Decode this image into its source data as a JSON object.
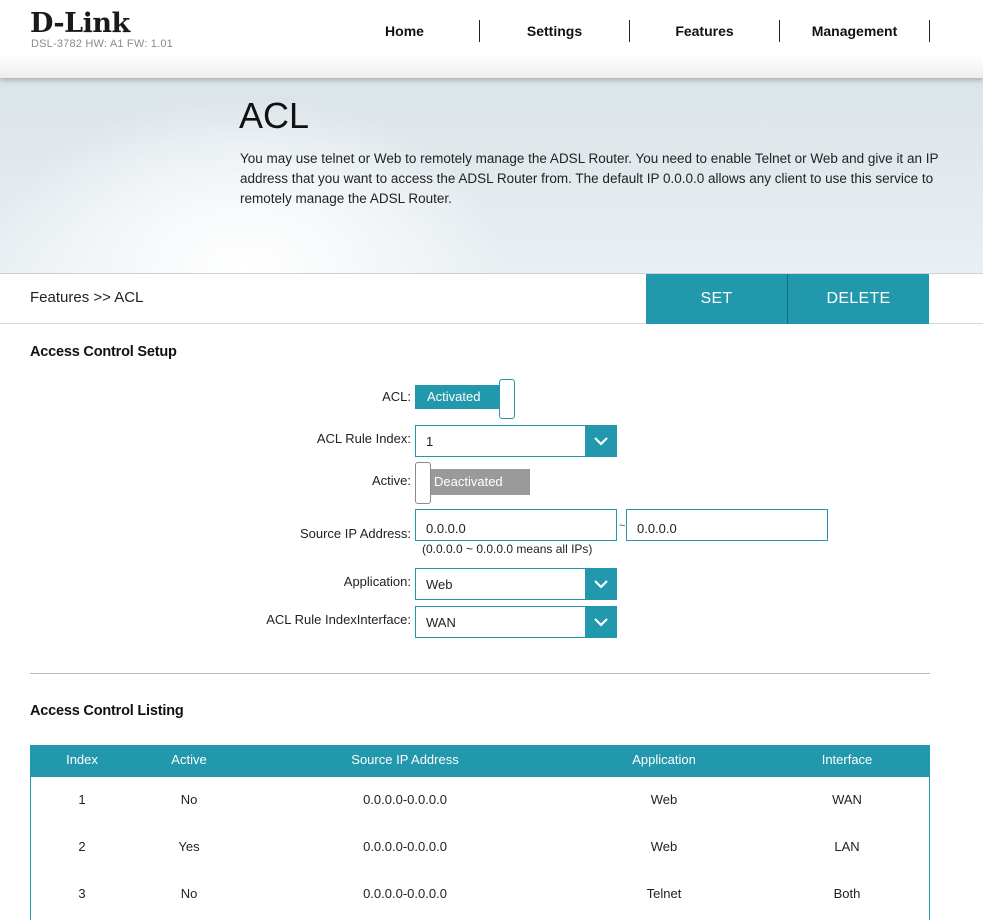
{
  "header": {
    "logo": "D-Link",
    "model_info": "DSL-3782   HW: A1   FW: 1.01",
    "nav": [
      "Home",
      "Settings",
      "Features",
      "Management"
    ]
  },
  "banner": {
    "title": "ACL",
    "description": "You may use telnet or Web to remotely manage the ADSL Router. You need to enable Telnet or Web and give it an IP address that you want to access the ADSL Router from. The default IP 0.0.0.0 allows any client to use this service to remotely manage the ADSL Router."
  },
  "breadcrumb": "Features >> ACL",
  "actions": {
    "set": "SET",
    "delete": "DELETE"
  },
  "setup": {
    "title": "Access Control Setup",
    "acl_label": "ACL:",
    "acl_state": "Activated",
    "rule_index_label": "ACL Rule Index:",
    "rule_index_value": "1",
    "active_label": "Active:",
    "active_state": "Deactivated",
    "source_ip_label": "Source IP Address:",
    "source_ip_start": "0.0.0.0",
    "source_ip_separator": "~",
    "source_ip_end": "0.0.0.0",
    "source_ip_hint": "(0.0.0.0 ~ 0.0.0.0 means all IPs)",
    "application_label": "Application:",
    "application_value": "Web",
    "interface_label": "ACL Rule IndexInterface:",
    "interface_value": "WAN"
  },
  "listing": {
    "title": "Access Control Listing",
    "columns": [
      "Index",
      "Active",
      "Source IP Address",
      "Application",
      "Interface"
    ],
    "rows": [
      [
        "1",
        "No",
        "0.0.0.0-0.0.0.0",
        "Web",
        "WAN"
      ],
      [
        "2",
        "Yes",
        "0.0.0.0-0.0.0.0",
        "Web",
        "LAN"
      ],
      [
        "3",
        "No",
        "0.0.0.0-0.0.0.0",
        "Telnet",
        "Both"
      ]
    ]
  },
  "colors": {
    "accent": "#2198ac",
    "inactive": "#9a9a9a"
  }
}
